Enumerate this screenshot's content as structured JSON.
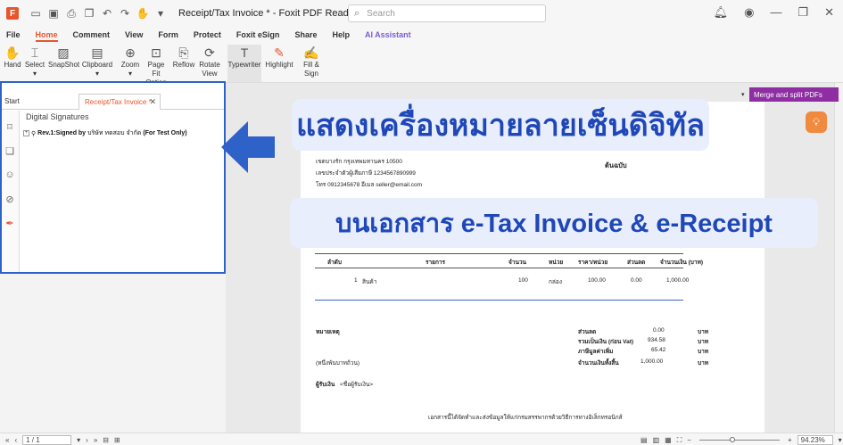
{
  "window": {
    "title": "Receipt/Tax Invoice * - Foxit PDF Reader",
    "search_placeholder": "Search",
    "logo_letter": "F"
  },
  "menu": [
    "File",
    "Home",
    "Comment",
    "View",
    "Form",
    "Protect",
    "Foxit eSign",
    "Share",
    "Help",
    "AI Assistant"
  ],
  "ribbon": {
    "hand": "Hand",
    "select": "Select",
    "snapshot": "SnapShot",
    "clipboard": "Clipboard",
    "zoom": "Zoom",
    "pagefit": "Page Fit",
    "pagefit2": "Option",
    "reflow": "Reflow",
    "rotate": "Rotate",
    "rotate2": "View",
    "typewriter": "Typewriter",
    "highlight": "Highlight",
    "fillsign": "Fill &",
    "fillsign2": "Sign"
  },
  "left_panel": {
    "tab_start": "Start",
    "tab_active": "Receipt/Tax Invoice *",
    "heading": "Digital Signatures",
    "sig_prefix": "Rev.1:Signed by",
    "sig_name": "บริษัท ทดสอบ จำกัด",
    "sig_suffix": "(For Test Only)"
  },
  "right_panel": {
    "merge_label": "Merge and split PDFs"
  },
  "document": {
    "addr1": "เขตบางรัก กรุงเทพมหานคร 10500",
    "taxid": "เลขประจำตัวผู้เสียภาษี 1234567890999",
    "contact": "โทร 0912345678 อีเมล seller@email.com",
    "original": "ต้นฉบับ",
    "col_no": "ลำดับ",
    "col_item": "รายการ",
    "col_qty": "จำนวน",
    "col_unit": "หน่วย",
    "col_price": "ราคา/หน่วย",
    "col_discount": "ส่วนลด",
    "col_amount": "จำนวนเงิน (บาท)",
    "row_no": "1",
    "row_item": "สินค้า",
    "row_qty": "100",
    "row_unit": "กล่อง",
    "row_price": "100.00",
    "row_discount": "0.00",
    "row_amount": "1,000.00",
    "remark": "หมายเหตุ",
    "amount_words": "(หนึ่งพันบาทถ้วน)",
    "payee": "ผู้รับเงิน",
    "payee_name": "<ชื่อผู้รับเงิน>",
    "sum_discount_label": "ส่วนลด",
    "sum_discount": "0.00",
    "sum_prevat_label": "รวมเป็นเงิน (ก่อน Vat)",
    "sum_prevat": "934.58",
    "sum_vat_label": "ภาษีมูลค่าเพิ่ม",
    "sum_vat": "65.42",
    "sum_total_label": "จำนวนเงินทั้งสิ้น",
    "sum_total": "1,000.00",
    "baht": "บาท",
    "footer": "เอกสารนี้ได้จัดทำและส่งข้อมูลให้แก่กรมสรรพากรด้วยวิธีการทางอิเล็กทรอนิกส์"
  },
  "overlay": {
    "callout1": "แสดงเครื่องหมายลายเซ็นดิจิทัล",
    "callout2": "บนเอกสาร e-Tax Invoice & e-Receipt",
    "accent": "#1f47b8",
    "arrow_color": "#2f62c9"
  },
  "status": {
    "page": "1 / 1",
    "zoom": "94.23%"
  }
}
